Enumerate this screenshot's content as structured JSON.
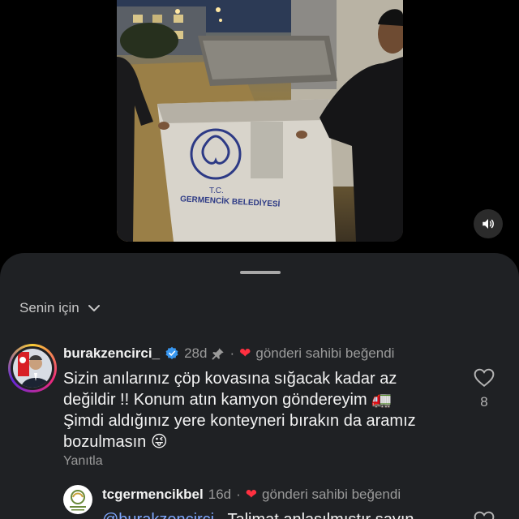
{
  "video": {
    "bin_text_top": "T.C.",
    "bin_text_bottom": "GERMENCİK BELEDİYESİ",
    "mute_icon": "speaker-icon"
  },
  "sheet": {
    "filter_label": "Senin için",
    "filter_icon": "chevron-down-icon"
  },
  "comments": [
    {
      "username": "burakzencirci_",
      "verified": true,
      "age": "28d",
      "pin_icon": "pin-icon",
      "liked_by_author": "gönderi sahibi beğendi",
      "text_lines": [
        "Sizin anılarınız çöp kovasına sığacak kadar az",
        "değildir !! Konum atın kamyon göndereyim 🚛",
        "Şimdi aldığınız yere konteyneri bırakın da aramız",
        "bozulmasın 😜"
      ],
      "reply_label": "Yanıtla",
      "like_count": "8"
    },
    {
      "username": "tcgermencikbel",
      "age": "16d",
      "separator": "·",
      "liked_by_author": "gönderi sahibi beğendi",
      "text_partial_mention": "@burakzencirci_",
      "text_partial_rest": "Talimat anlaşılmıştır sayın"
    }
  ],
  "colors": {
    "sheet_bg": "#1f2124",
    "heart": "#ff3040",
    "verified": "#3897f0",
    "mention": "#7ea7ff"
  }
}
